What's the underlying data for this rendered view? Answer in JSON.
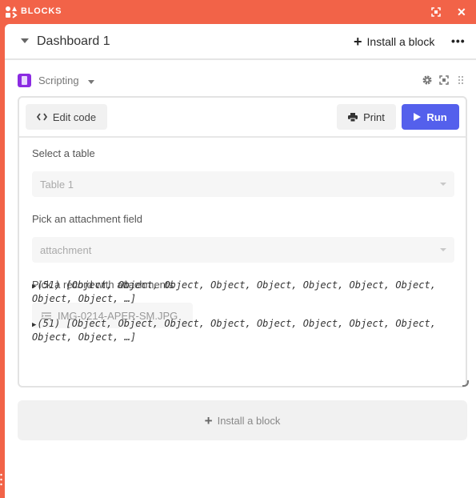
{
  "app": {
    "title": "BLOCKS",
    "brand_color": "#f26348",
    "icons": {
      "logo": "blocks-logo-icon",
      "fullscreen": "fullscreen-icon",
      "close": "close-icon"
    },
    "close_glyph": "✕"
  },
  "dashboard": {
    "title": "Dashboard 1",
    "install_label": "Install a block",
    "install_icon": "+",
    "more_glyph": "•••"
  },
  "block": {
    "name": "Scripting",
    "icon_color": "#8b2be2",
    "icons": {
      "settings": "gear-icon",
      "fullscreen": "fullscreen-icon",
      "drag": "drag-handle-icon"
    },
    "toolbar": {
      "edit_code_label": "Edit code",
      "print_label": "Print",
      "run_label": "Run",
      "run_color": "#5460ec"
    },
    "form": {
      "table": {
        "label": "Select a table",
        "value": "Table 1"
      },
      "field": {
        "label": "Pick an attachment field",
        "value": "attachment"
      },
      "record": {
        "label": "Pick a record with attachments",
        "value": "IMG-0214-APER-SM.JPG"
      }
    },
    "console": [
      {
        "toggle": "▶",
        "text": "(51) [Object, Object, Object, Object, Object, Object, Object, Object, Object, Object, …]"
      },
      {
        "toggle": "▶",
        "text": "(51) [Object, Object, Object, Object, Object, Object, Object, Object, Object, Object, …]"
      }
    ]
  },
  "install_block": {
    "label": "Install a block",
    "icon": "+"
  }
}
